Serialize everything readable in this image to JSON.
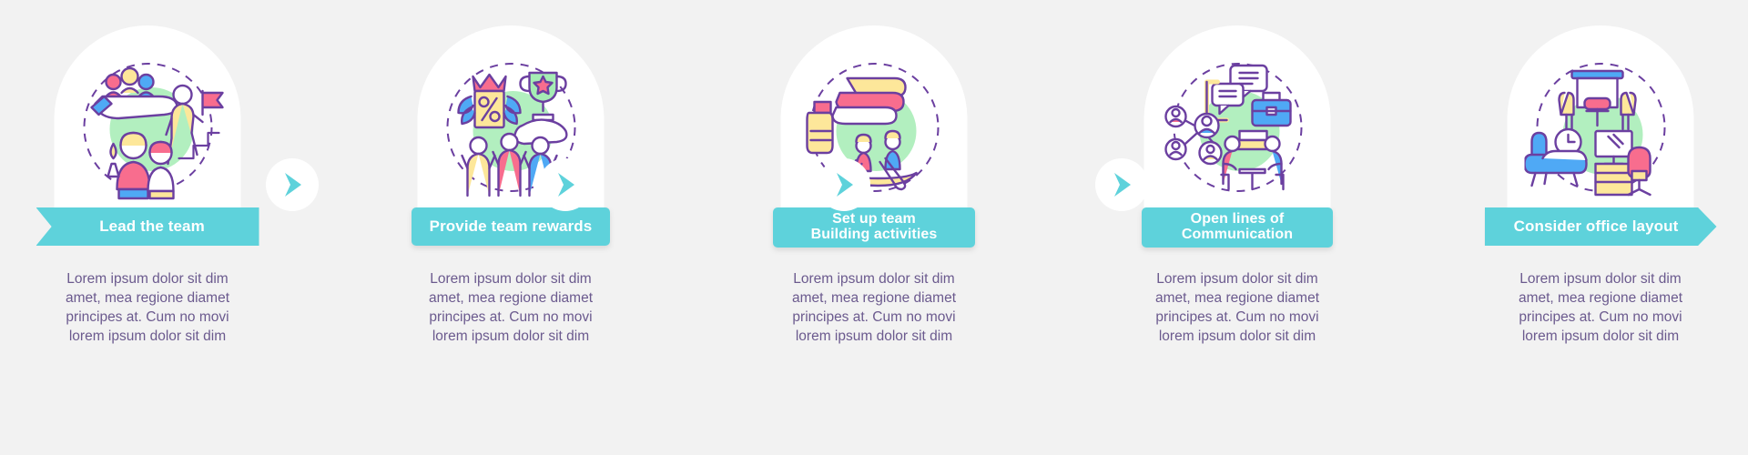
{
  "theme": {
    "background": "#f2f2f2",
    "banner_color": "#5ed2db",
    "banner_text_color": "#ffffff",
    "body_text_color": "#6b5a8e",
    "card_color": "#ffffff",
    "icon_outline": "#6b3fa0",
    "icon_green": "#a5ecb4",
    "icon_pink": "#f86d8e",
    "icon_yellow": "#fde79a",
    "icon_blue": "#4fa9f5"
  },
  "steps": [
    {
      "index": 1,
      "title_line1": "Lead the team",
      "title_line2": "",
      "icon": "team-leadership-icon",
      "banner_shape": "notch-left",
      "description": [
        "Lorem ipsum dolor sit dim",
        "amet, mea regione diamet",
        "principes at. Cum no movi",
        "lorem ipsum dolor sit dim"
      ]
    },
    {
      "index": 2,
      "title_line1": "Provide team rewards",
      "title_line2": "",
      "icon": "team-rewards-icon",
      "banner_shape": "rounded",
      "description": [
        "Lorem ipsum dolor sit dim",
        "amet, mea regione diamet",
        "principes at. Cum no movi",
        "lorem ipsum dolor sit dim"
      ]
    },
    {
      "index": 3,
      "title_line1": "Set up team",
      "title_line2": "Building activities",
      "icon": "team-building-icon",
      "banner_shape": "rounded",
      "description": [
        "Lorem ipsum dolor sit dim",
        "amet, mea regione diamet",
        "principes at. Cum no movi",
        "lorem ipsum dolor sit dim"
      ]
    },
    {
      "index": 4,
      "title_line1": "Open lines of",
      "title_line2": "Communication",
      "icon": "communication-icon",
      "banner_shape": "rounded",
      "description": [
        "Lorem ipsum dolor sit dim",
        "amet, mea regione diamet",
        "principes at. Cum no movi",
        "lorem ipsum dolor sit dim"
      ]
    },
    {
      "index": 5,
      "title_line1": "Consider office layout",
      "title_line2": "",
      "icon": "office-layout-icon",
      "banner_shape": "point-right",
      "description": [
        "Lorem ipsum dolor sit dim",
        "amet, mea regione diamet",
        "principes at. Cum no movi",
        "lorem ipsum dolor sit dim"
      ]
    }
  ],
  "connectors": [
    {
      "name": "chevron-right-icon"
    },
    {
      "name": "chevron-right-icon"
    },
    {
      "name": "chevron-right-icon"
    },
    {
      "name": "chevron-right-icon"
    }
  ]
}
